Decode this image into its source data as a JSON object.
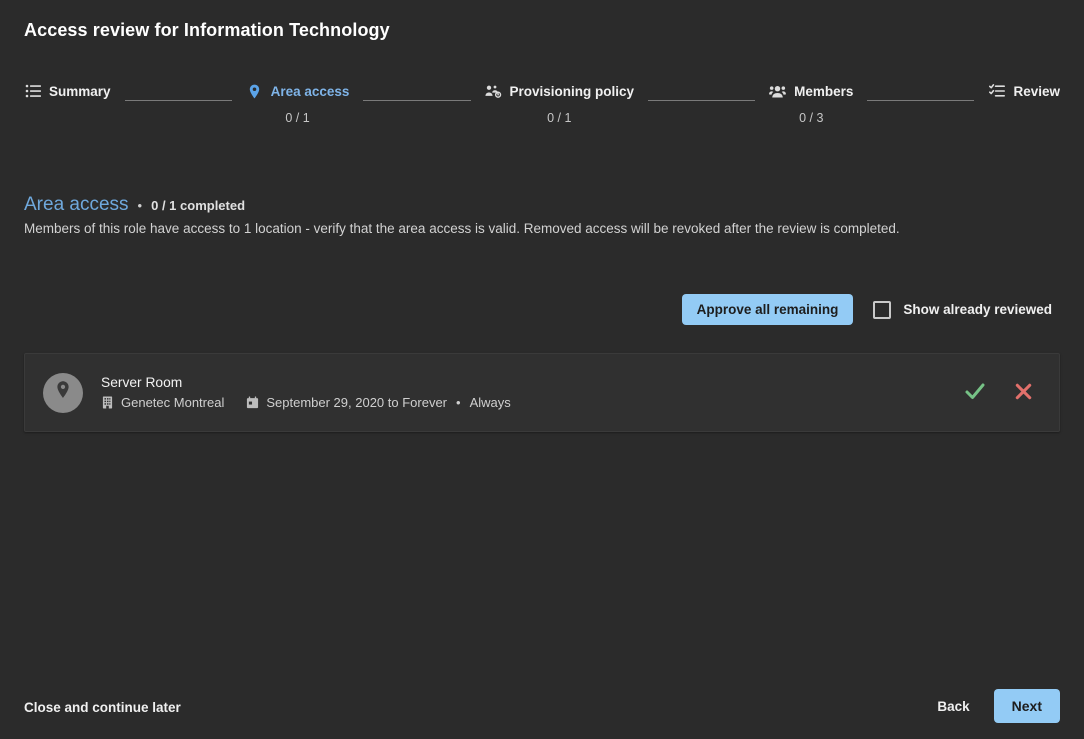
{
  "page": {
    "title": "Access review for Information Technology",
    "accent_color": "#93cbf5",
    "link_color": "#6fa8dc",
    "background_color": "#2b2b2b"
  },
  "stepper": {
    "steps": [
      {
        "label": "Summary",
        "icon": "list-icon",
        "count": "",
        "active": false
      },
      {
        "label": "Area access",
        "icon": "map-pin-icon",
        "count": "0 / 1",
        "active": true
      },
      {
        "label": "Provisioning policy",
        "icon": "policy-icon",
        "count": "0 / 1",
        "active": false
      },
      {
        "label": "Members",
        "icon": "users-icon",
        "count": "0 / 3",
        "active": false
      },
      {
        "label": "Review",
        "icon": "checklist-icon",
        "count": "",
        "active": false
      }
    ]
  },
  "section": {
    "title": "Area access",
    "separator": "•",
    "progress": "0 / 1 completed",
    "description": "Members of this role have access to 1 location - verify that the area access is valid. Removed access will be revoked after the review is completed."
  },
  "actions": {
    "approve_all_label": "Approve all remaining",
    "show_reviewed_label": "Show already reviewed",
    "show_reviewed_checked": false
  },
  "items": [
    {
      "name": "Server Room",
      "avatar_icon": "map-pin-icon",
      "location": "Genetec Montreal",
      "location_icon": "building-icon",
      "schedule": "September 29, 2020 to Forever",
      "schedule_icon": "calendar-icon",
      "separator": "•",
      "recurrence": "Always",
      "approve_icon": "check-icon",
      "reject_icon": "cross-icon",
      "approve_color": "#76c286",
      "reject_color": "#e2706b"
    }
  ],
  "footer": {
    "close_label": "Close and continue later",
    "back_label": "Back",
    "next_label": "Next"
  }
}
